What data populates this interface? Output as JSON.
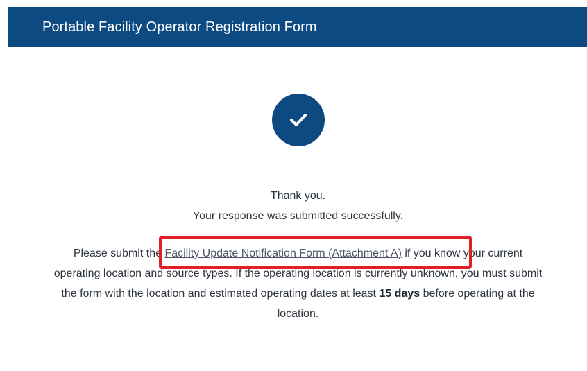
{
  "header": {
    "title": "Portable Facility Operator Registration Form"
  },
  "status": {
    "icon": "checkmark-icon",
    "thank_you": "Thank you.",
    "submitted": "Your response was submitted successfully."
  },
  "instructions": {
    "before_link": "Please submit the ",
    "link_text": "Facility Update Notification Form (Attachment A)",
    "after_link": " if you know your current operating location and source types. If the operating location is currently unknown, you must submit the form with the location and estimated operating dates at least ",
    "bold_text": "15 days",
    "end_text": " before operating at the location."
  },
  "colors": {
    "header_bg": "#0d4a82",
    "highlight": "#e21f26"
  }
}
